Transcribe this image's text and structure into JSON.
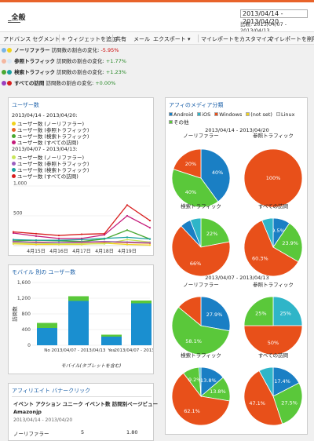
{
  "header": {
    "title": "_全般",
    "date_range": "2013/04/14 - 2013/04/20",
    "compare_label": "比較:",
    "compare_range": "2013/04/07 - 2013/04/13"
  },
  "toolbar": {
    "items": [
      "アドバンス セグメント",
      "+ ウィジェットを追加",
      "共有",
      "メール",
      "エクスポート ▾",
      "マイレポートをカスタマイズ",
      "マイレポートを削除"
    ]
  },
  "segments": [
    {
      "name": "ノーリファラー",
      "label": "訪問数の割合の変化:",
      "change": "-5.95%",
      "color": "#f0d21b"
    },
    {
      "name": "参照トラフィック",
      "label": "訪問数の割合の変化:",
      "change": "+1.77%",
      "color": "#e8632a"
    },
    {
      "name": "検索トラフィック",
      "label": "訪問数の割合の変化:",
      "change": "+1.23%",
      "color": "#4aa832"
    },
    {
      "name": "すべての訪問",
      "label": "訪問数の割合の変化:",
      "change": "+0.00%",
      "color": "#c41a7a"
    }
  ],
  "users_card": {
    "title": "ユーザー数",
    "period1": "2013/04/14 - 2013/04/20:",
    "period2": "2013/04/07 - 2013/04/13:",
    "legend1": [
      "ユーザー数 (ノーリファラー)",
      "ユーザー数 (参照トラフィック)",
      "ユーザー数 (検索トラフィック)",
      "ユーザー数 (すべての訪問)"
    ],
    "legend2": [
      "ユーザー数 (ノーリファラー)",
      "ユーザー数 (参照トラフィック)",
      "ユーザー数 (検索トラフィック)",
      "ユーザー数 (すべての訪問)"
    ],
    "legend1_colors": [
      "#f0d21b",
      "#e8632a",
      "#4aa832",
      "#c41a7a"
    ],
    "legend2_colors": [
      "#c8e65a",
      "#9a5fc0",
      "#1aa0a0",
      "#d81f1f"
    ]
  },
  "mobile_card": {
    "title": "モバイル 別の ユーザー数",
    "xlabel": "モバイル(タブレットを含む)",
    "ylabel": "訪問数",
    "date_label": "2013/04/07 -",
    "date_label2": "2013/04/13"
  },
  "media_card": {
    "title": "アフィのメディア分類",
    "legend": [
      "Android",
      "iOS",
      "Windows",
      "(not set)",
      "Linux",
      "その他"
    ],
    "legend_colors": [
      "#1a7fc4",
      "#2fb5c8",
      "#e8501a",
      "#f0d21b",
      "#eaeaea",
      "#5ac83a"
    ],
    "period1": "2013/04/14 - 2013/04/20",
    "period2": "2013/04/07 - 2013/04/13",
    "pies": [
      {
        "title": "ノーリファラー",
        "slices": [
          40,
          40,
          20,
          0
        ],
        "labels": [
          "40%",
          "40%",
          "20%",
          ""
        ],
        "colors": [
          "#1a7fc4",
          "#5ac83a",
          "#e8501a",
          "#ffffff"
        ]
      },
      {
        "title": "参照トラフィック",
        "slices": [
          100
        ],
        "labels": [
          "100%"
        ],
        "colors": [
          "#e8501a"
        ]
      },
      {
        "title": "検索トラフィック",
        "slices": [
          22,
          66,
          6,
          6
        ],
        "labels": [
          "22%",
          "66%",
          "",
          ""
        ],
        "colors": [
          "#5ac83a",
          "#e8501a",
          "#1a7fc4",
          "#2fb5c8"
        ]
      },
      {
        "title": "すべての訪問",
        "slices": [
          9.5,
          23.9,
          60.3,
          6.3
        ],
        "labels": [
          "9.5%",
          "23.9%",
          "60.3%",
          ""
        ],
        "colors": [
          "#1a7fc4",
          "#5ac83a",
          "#e8501a",
          "#2fb5c8"
        ]
      },
      {
        "title": "ノーリファラー",
        "slices": [
          27.9,
          58.1,
          14
        ],
        "labels": [
          "27.9%",
          "58.1%",
          ""
        ],
        "colors": [
          "#1a7fc4",
          "#5ac83a",
          "#e8501a"
        ]
      },
      {
        "title": "参照トラフィック",
        "slices": [
          25,
          50,
          25
        ],
        "labels": [
          "25%",
          "50%",
          "25%"
        ],
        "colors": [
          "#2fb5c8",
          "#e8501a",
          "#5ac83a"
        ]
      },
      {
        "title": "検索トラフィック",
        "slices": [
          13.8,
          13.8,
          62.1,
          9.2,
          1.1
        ],
        "labels": [
          "13.8%",
          "13.8%",
          "62.1%",
          "9.2%",
          ""
        ],
        "colors": [
          "#1a7fc4",
          "#5ac83a",
          "#e8501a",
          "#5ac83a",
          "#2fb5c8"
        ]
      },
      {
        "title": "すべての訪問",
        "slices": [
          17.4,
          27.5,
          47.1,
          8
        ],
        "labels": [
          "17.4%",
          "27.5%",
          "47.1%",
          ""
        ],
        "colors": [
          "#1a7fc4",
          "#5ac83a",
          "#e8501a",
          "#2fb5c8"
        ]
      }
    ]
  },
  "affiliate_card": {
    "title": "アフィリエイト バナークリック",
    "headers": [
      "イベント アクション",
      "ユニーク イベント数",
      "訪問別ページビュー"
    ],
    "group": "Amazonjp",
    "date": "2013/04/14 - 2013/04/20",
    "row_label": "ノーリファラー",
    "row_v1": "5",
    "row_v2": "1.80"
  },
  "chart_data": [
    {
      "type": "line",
      "categories": [
        "4月15日",
        "4月16日",
        "4月17日",
        "4月18日",
        "4月19日"
      ],
      "yticks": [
        "1,000",
        "500"
      ],
      "ylim": [
        0,
        1000
      ],
      "series": [
        {
          "name": "ユーザー数 (ノーリファラー)",
          "color": "#f0d21b",
          "values": [
            30,
            20,
            20,
            20,
            40,
            20,
            10
          ]
        },
        {
          "name": "ユーザー数 (参照トラフィック)",
          "color": "#e8632a",
          "values": [
            60,
            60,
            50,
            50,
            60,
            50,
            40
          ]
        },
        {
          "name": "ユーザー数 (検索トラフィック)",
          "color": "#4aa832",
          "values": [
            80,
            90,
            80,
            70,
            110,
            260,
            110
          ]
        },
        {
          "name": "ユーザー数 (すべての訪問)",
          "color": "#c41a7a",
          "values": [
            210,
            160,
            120,
            120,
            180,
            500,
            300
          ]
        },
        {
          "name": "ユーザー数 (ノーリファラー)",
          "color": "#c8e65a",
          "values": [
            40,
            40,
            30,
            30,
            30,
            100,
            60
          ]
        },
        {
          "name": "ユーザー数 (参照トラフィック)",
          "color": "#9a5fc0",
          "values": [
            70,
            50,
            50,
            60,
            70,
            60,
            50
          ]
        },
        {
          "name": "ユーザー数 (検索トラフィック)",
          "color": "#1aa0a0",
          "values": [
            100,
            90,
            90,
            100,
            120,
            140,
            110
          ]
        },
        {
          "name": "ユーザー数 (すべての訪問)",
          "color": "#d81f1f",
          "values": [
            230,
            200,
            170,
            190,
            200,
            680,
            420
          ]
        }
      ]
    },
    {
      "type": "bar",
      "categories": [
        "No",
        "2013/04/07 - 2013/04/13",
        "Yes",
        "2013/04/07 - 2013/04/13"
      ],
      "yticks": [
        "1,600",
        "1,200",
        "800",
        "400",
        "0"
      ],
      "ylim": [
        0,
        1600
      ],
      "series": [
        {
          "name": "main",
          "color": "#1a8fd0",
          "values": [
            440,
            1130,
            220,
            1070
          ]
        },
        {
          "name": "top",
          "color": "#5ac83a",
          "values": [
            130,
            120,
            50,
            70
          ]
        }
      ]
    }
  ]
}
